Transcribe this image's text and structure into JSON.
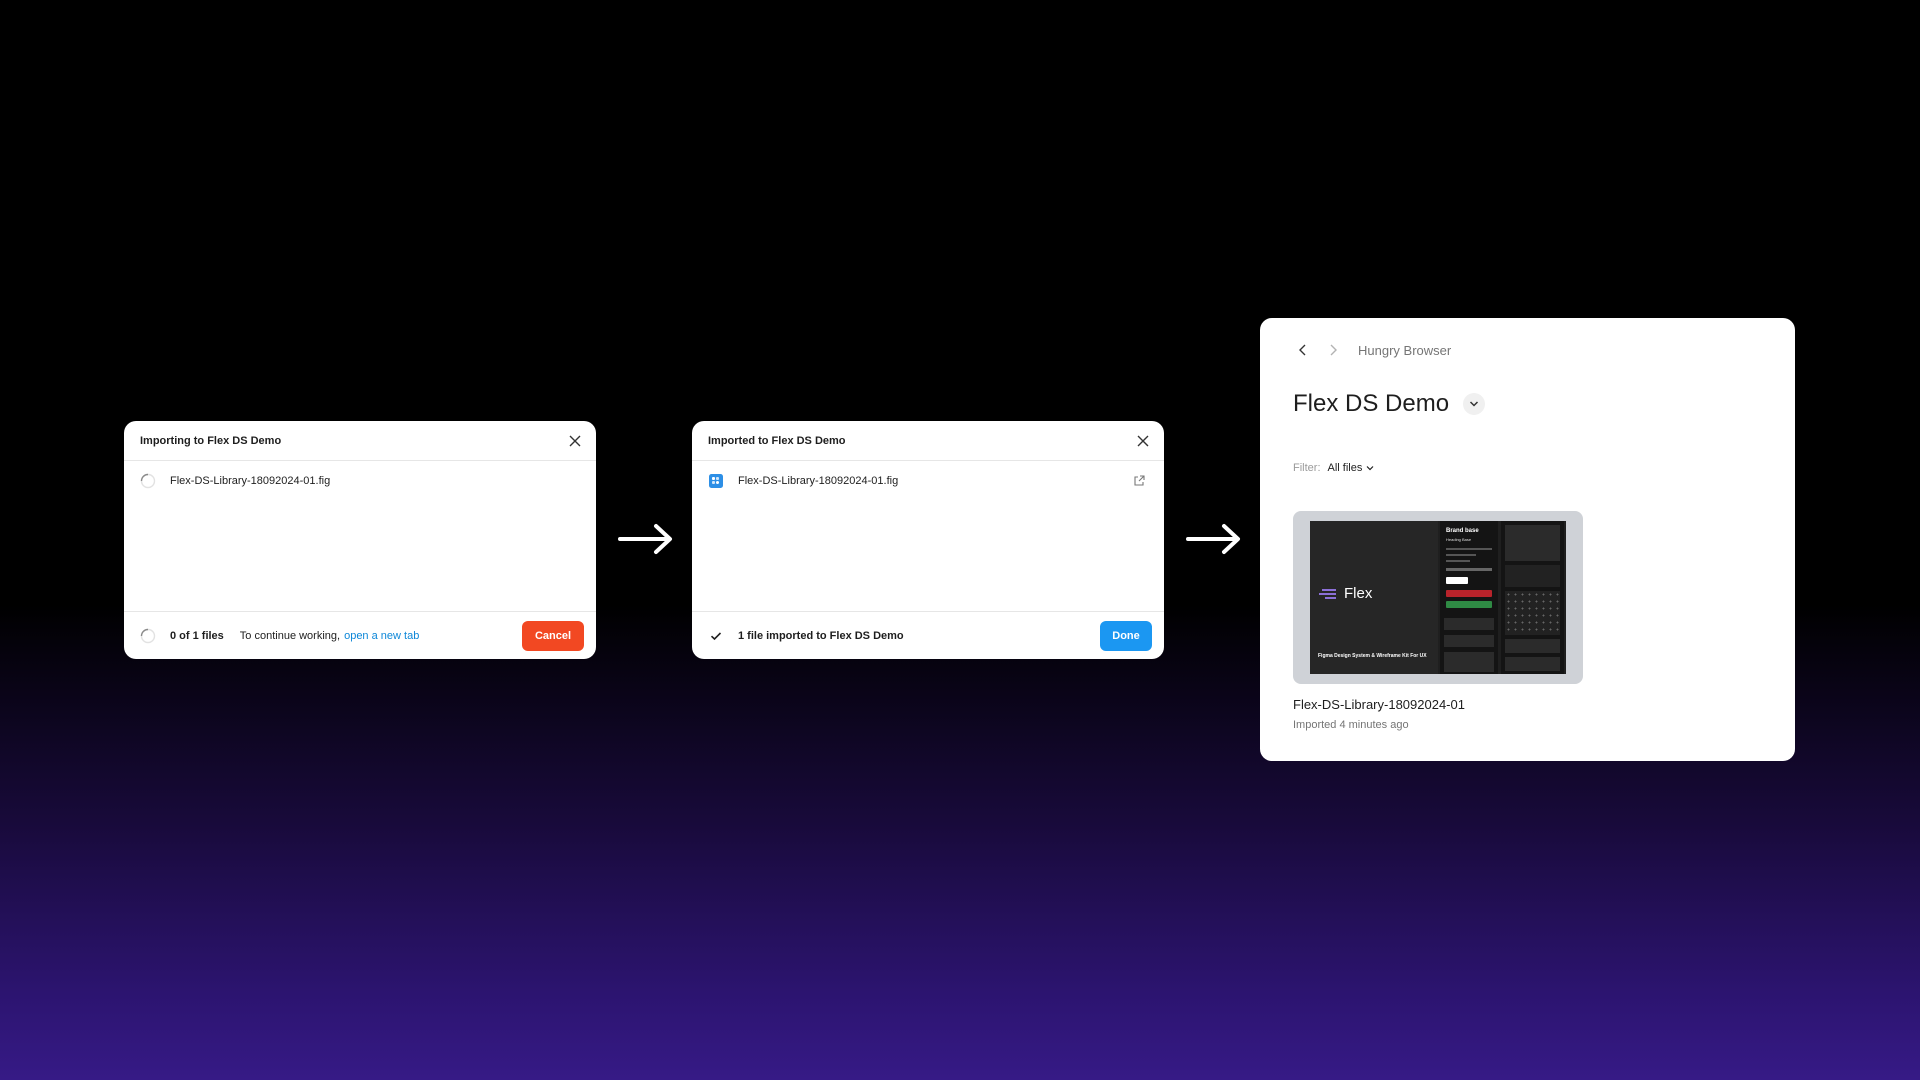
{
  "importing_dialog": {
    "title": "Importing to Flex DS Demo",
    "file_name": "Flex-DS-Library-18092024-01.fig",
    "progress_count": "0 of 1 files",
    "continue_text": "To continue working,",
    "open_tab_link": "open a new tab",
    "cancel_label": "Cancel",
    "cancel_color": "#f24822"
  },
  "imported_dialog": {
    "title": "Imported to Flex DS Demo",
    "file_name": "Flex-DS-Library-18092024-01.fig",
    "status_text": "1 file imported to Flex DS Demo",
    "done_label": "Done",
    "done_color": "#1b97f2"
  },
  "browser": {
    "breadcrumb": "Hungry Browser",
    "project_title": "Flex DS Demo",
    "filter_label": "Filter:",
    "filter_value": "All files",
    "file": {
      "name": "Flex-DS-Library-18092024-01",
      "meta": "Imported 4 minutes ago",
      "thumb_logo_text": "Flex",
      "thumb_caption": "Figma Design System & Wireframe Kit For UX",
      "thumb_panel_title": "Brand base",
      "thumb_panel_subtitle": "Heading Base"
    }
  },
  "icons": [
    "close-icon",
    "spinner-icon",
    "fig-file-icon",
    "external-link-icon",
    "check-icon",
    "arrow-right-icon",
    "chevron-left-icon",
    "chevron-right-icon",
    "chevron-down-icon"
  ]
}
